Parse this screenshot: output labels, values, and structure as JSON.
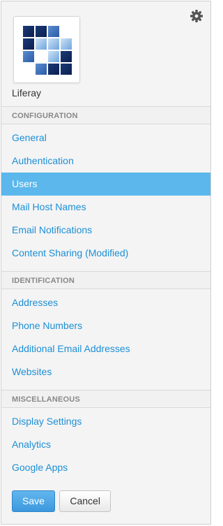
{
  "site": {
    "name": "Liferay"
  },
  "icons": {
    "settings": "gear-icon",
    "logo": "liferay-logo"
  },
  "colors": {
    "link": "#1c8fd6",
    "active_bg": "#5bb7ec",
    "primary_button": "#4aa4e4"
  },
  "sections": [
    {
      "title": "CONFIGURATION",
      "items": [
        {
          "label": "General",
          "active": false
        },
        {
          "label": "Authentication",
          "active": false
        },
        {
          "label": "Users",
          "active": true
        },
        {
          "label": "Mail Host Names",
          "active": false
        },
        {
          "label": "Email Notifications",
          "active": false
        },
        {
          "label": "Content Sharing (Modified)",
          "active": false
        }
      ]
    },
    {
      "title": "IDENTIFICATION",
      "items": [
        {
          "label": "Addresses",
          "active": false
        },
        {
          "label": "Phone Numbers",
          "active": false
        },
        {
          "label": "Additional Email Addresses",
          "active": false
        },
        {
          "label": "Websites",
          "active": false
        }
      ]
    },
    {
      "title": "MISCELLANEOUS",
      "items": [
        {
          "label": "Display Settings",
          "active": false
        },
        {
          "label": "Analytics",
          "active": false
        },
        {
          "label": "Google Apps",
          "active": false
        }
      ]
    }
  ],
  "buttons": {
    "save": "Save",
    "cancel": "Cancel"
  }
}
